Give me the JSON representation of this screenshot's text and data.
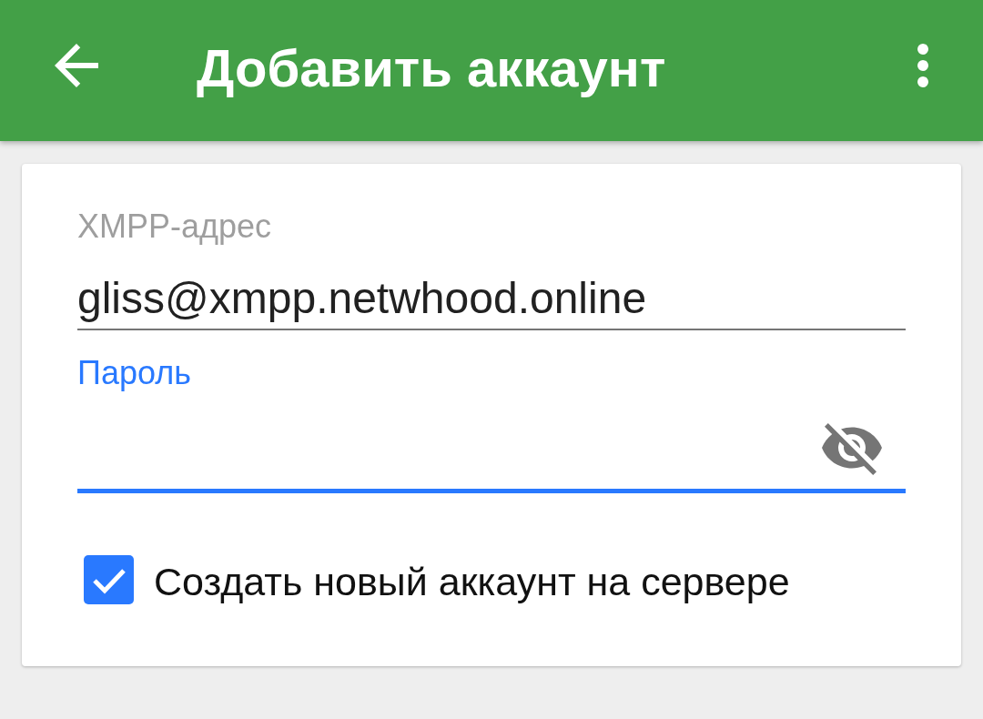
{
  "app_bar": {
    "title": "Добавить аккаунт"
  },
  "form": {
    "fields": [
      {
        "kind": "text",
        "label": "XMPP-адрес",
        "value": "gliss@xmpp.netwhood.online",
        "focused": false
      },
      {
        "kind": "password",
        "label": "Пароль",
        "focused": true
      }
    ],
    "checkbox": {
      "label": "Создать новый аккаунт на сервере",
      "checked": true
    }
  }
}
